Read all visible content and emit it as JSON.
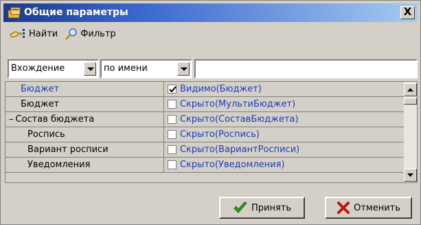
{
  "window": {
    "title": "Общие параметры",
    "close_label": "X"
  },
  "toolbar": {
    "find_label": "Найти",
    "filter_label": "Фильтр"
  },
  "filter": {
    "mode": "Вхождение",
    "field": "по имени",
    "search_value": ""
  },
  "grid": {
    "rows": [
      {
        "name": "Бюджет",
        "value": "Видимо(Бюджет)",
        "checked": true,
        "selected": true,
        "indent": 0,
        "prefix": ""
      },
      {
        "name": "Бюджет",
        "value": "Скрыто(МультиБюджет)",
        "checked": false,
        "selected": false,
        "indent": 0,
        "prefix": ""
      },
      {
        "name": "Состав бюджета",
        "value": "Скрыто(СоставБюджета)",
        "checked": false,
        "selected": false,
        "indent": 0,
        "prefix": "–"
      },
      {
        "name": "Роспись",
        "value": "Скрыто(Роспись)",
        "checked": false,
        "selected": false,
        "indent": 1,
        "prefix": ""
      },
      {
        "name": "Вариант росписи",
        "value": "Скрыто(ВариантРосписи)",
        "checked": false,
        "selected": false,
        "indent": 1,
        "prefix": ""
      },
      {
        "name": "Уведомления",
        "value": "Скрыто(Уведомления)",
        "checked": false,
        "selected": false,
        "indent": 1,
        "prefix": ""
      }
    ]
  },
  "buttons": {
    "accept_label": "Принять",
    "cancel_label": "Отменить"
  },
  "colors": {
    "title_start": "#1a3a8c",
    "title_end": "#a6caf0",
    "selected_text": "#1a3dbb",
    "value_text": "#1a3dbb",
    "accept_icon": "#2e9e1e",
    "cancel_icon": "#c0141c"
  }
}
